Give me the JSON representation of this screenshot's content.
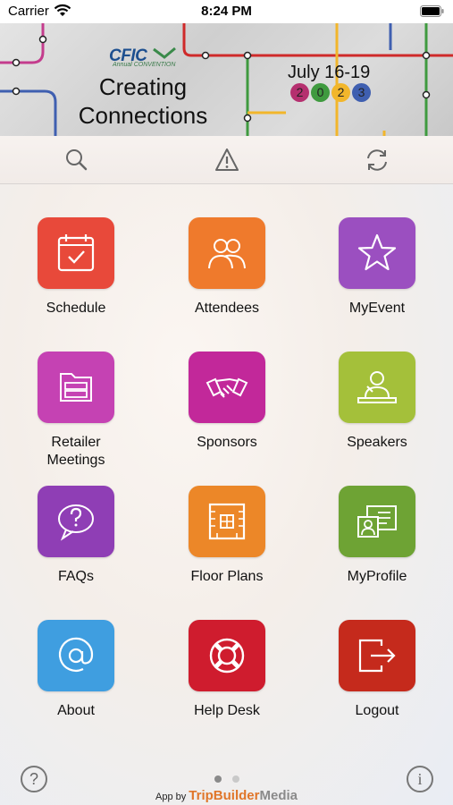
{
  "status_bar": {
    "carrier": "Carrier",
    "time": "8:24 PM"
  },
  "banner": {
    "logo": "CFIC",
    "logo_sub": "Annual CONVENTION",
    "title_line1": "Creating",
    "title_line2": "Connections",
    "dates": "July 16-19",
    "year_digits": [
      {
        "digit": "2",
        "color": "#b5306f"
      },
      {
        "digit": "0",
        "color": "#3f9a3f"
      },
      {
        "digit": "2",
        "color": "#f2b62b"
      },
      {
        "digit": "3",
        "color": "#3f5fb0"
      }
    ]
  },
  "toolbar": {
    "icons": [
      "search-icon",
      "alert-icon",
      "refresh-icon"
    ]
  },
  "tiles": [
    {
      "label": "Schedule",
      "color": "#e8493a",
      "icon": "calendar-icon"
    },
    {
      "label": "Attendees",
      "color": "#ef7a2c",
      "icon": "people-icon"
    },
    {
      "label": "MyEvent",
      "color": "#9b4fc0",
      "icon": "star-icon"
    },
    {
      "label": "Retailer\nMeetings",
      "color": "#c542b3",
      "icon": "folder-icon"
    },
    {
      "label": "Sponsors",
      "color": "#c2289a",
      "icon": "handshake-icon"
    },
    {
      "label": "Speakers",
      "color": "#a4c03a",
      "icon": "speaker-icon"
    },
    {
      "label": "FAQs",
      "color": "#8f3eb5",
      "icon": "question-bubble-icon"
    },
    {
      "label": "Floor Plans",
      "color": "#ec8728",
      "icon": "floor-plan-icon"
    },
    {
      "label": "MyProfile",
      "color": "#6ea334",
      "icon": "profile-card-icon"
    },
    {
      "label": "About",
      "color": "#3f9ee0",
      "icon": "at-icon"
    },
    {
      "label": "Help Desk",
      "color": "#cf1c2e",
      "icon": "lifebuoy-icon"
    },
    {
      "label": "Logout",
      "color": "#c52a1c",
      "icon": "logout-icon"
    }
  ],
  "bottom": {
    "help": "?",
    "info": "i",
    "credit_prefix": "App by",
    "credit_brand": "TripBuilder",
    "credit_brand2": "Media",
    "page_count": 2,
    "current_page": 1
  }
}
